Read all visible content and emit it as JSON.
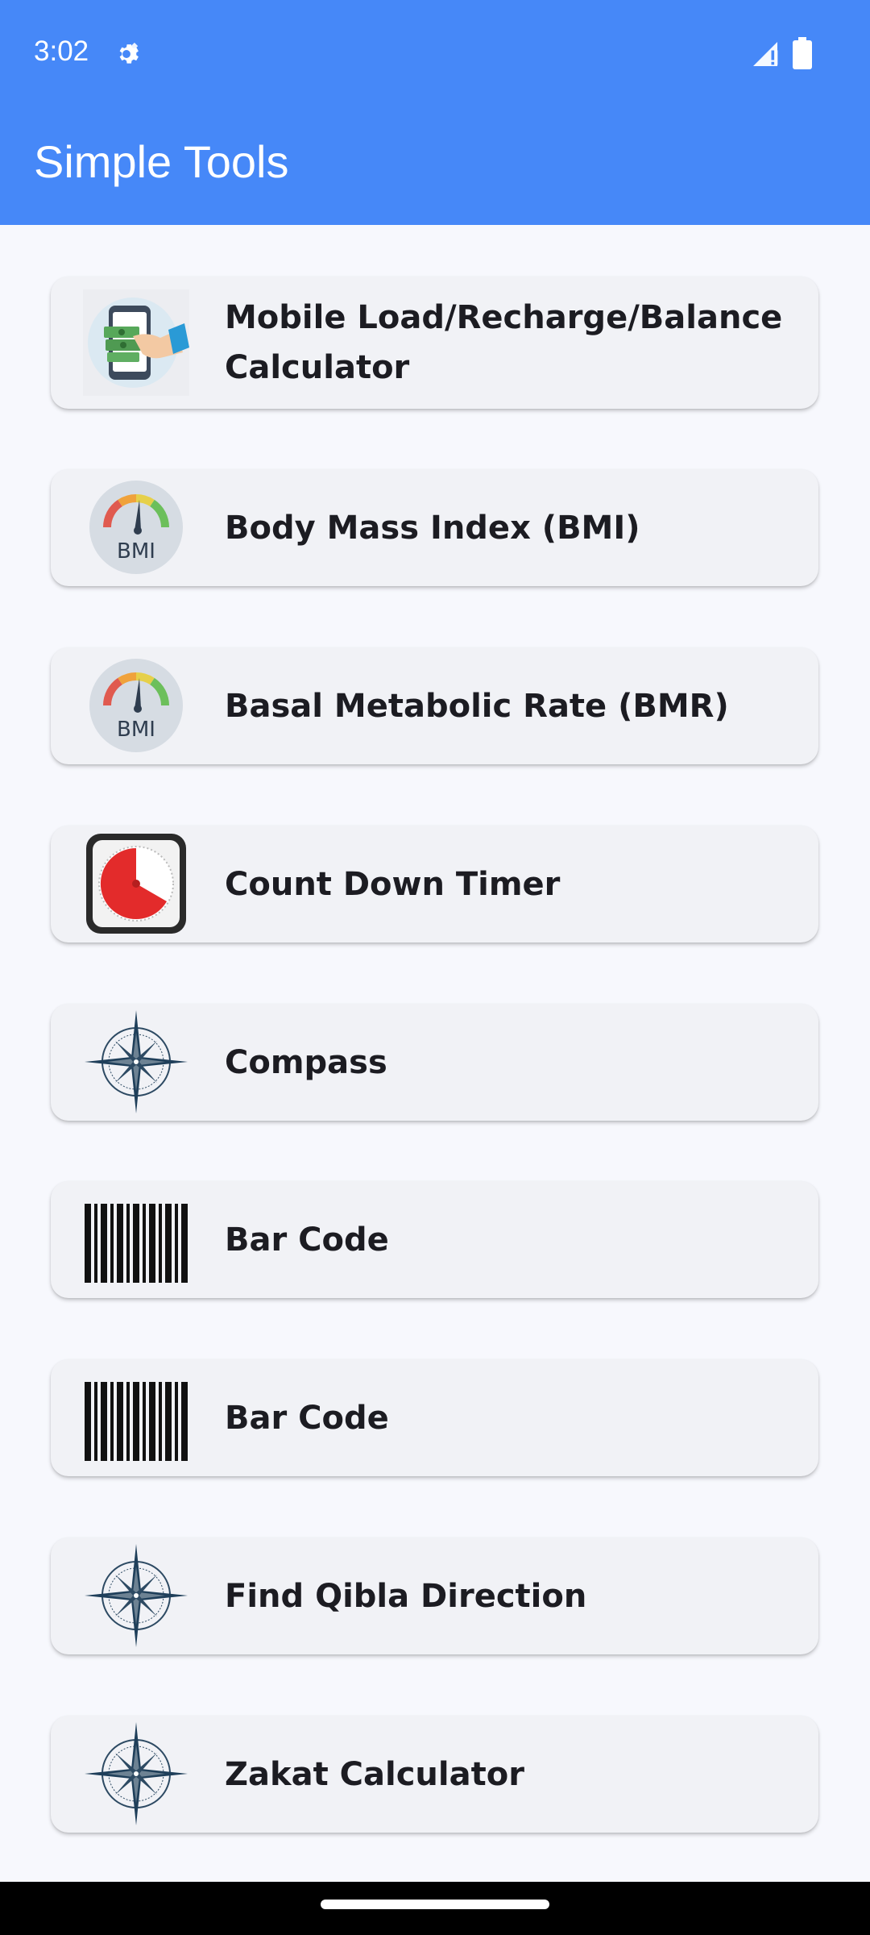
{
  "status_bar": {
    "time": "3:02",
    "icons": [
      "settings-gear-icon",
      "signal-icon",
      "battery-icon"
    ]
  },
  "app_bar": {
    "title": "Simple Tools",
    "color": "#4688f8"
  },
  "tools": [
    {
      "label": "Mobile Load/Recharge/Balance Calculator",
      "icon": "mobile-recharge-icon"
    },
    {
      "label": "Body Mass Index (BMI)",
      "icon": "bmi-gauge-icon"
    },
    {
      "label": "Basal Metabolic Rate (BMR)",
      "icon": "bmi-gauge-icon"
    },
    {
      "label": "Count Down Timer",
      "icon": "timer-icon"
    },
    {
      "label": "Compass",
      "icon": "compass-rose-icon"
    },
    {
      "label": "Bar Code",
      "icon": "barcode-icon"
    },
    {
      "label": "Bar Code",
      "icon": "barcode-icon"
    },
    {
      "label": "Find Qibla Direction",
      "icon": "compass-rose-icon"
    },
    {
      "label": "Zakat Calculator",
      "icon": "compass-rose-icon"
    }
  ],
  "bmi_icon_text": "BMI"
}
